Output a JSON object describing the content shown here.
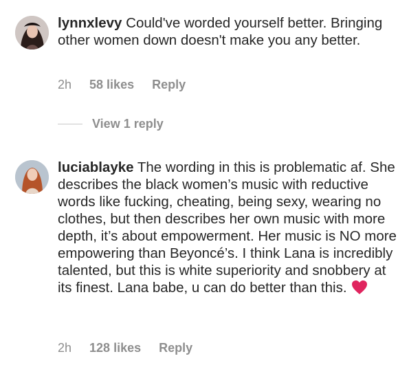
{
  "comments": [
    {
      "username": "lynnxlevy",
      "text": " Could've worded yourself better. Bringing other women down doesn't make you any better.",
      "time": "2h",
      "likes": "58 likes",
      "reply": "Reply",
      "avatar_icon": "profile-photo-icon"
    },
    {
      "username": "luciablayke",
      "text": " The wording in this is problematic af. She describes the black women’s music with reductive words like fucking, cheating, being sexy, wearing no clothes, but then describes her own music with more depth, it’s about empowerment. Her music is NO more empowering than Beyoncé’s. I think Lana is incredibly talented, but this is white superiority and snobbery at its finest. Lana babe, u can do better than this.",
      "emoji": "red-heart-icon",
      "time": "2h",
      "likes": "128 likes",
      "reply": "Reply",
      "avatar_icon": "profile-photo-icon"
    }
  ],
  "view_replies": "View 1 reply",
  "colors": {
    "text": "#262626",
    "meta": "#8e8e8e",
    "heart": "#e0245e"
  }
}
